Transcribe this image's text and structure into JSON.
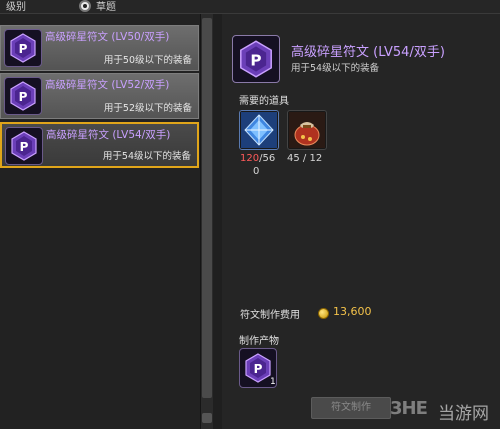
{
  "topbar": {
    "level_label": "级别",
    "radio_label": "草题"
  },
  "recipes": [
    {
      "title": "高级碎星符文 (LV50/双手)",
      "subtitle": "用于50级以下的装备",
      "selected": false
    },
    {
      "title": "高级碎星符文 (LV52/双手)",
      "subtitle": "用于52级以下的装备",
      "selected": false
    },
    {
      "title": "高级碎星符文 (LV54/双手)",
      "subtitle": "用于54级以下的装备",
      "selected": true
    }
  ],
  "detail": {
    "title": "高级碎星符文 (LV54/双手)",
    "subtitle": "用于54级以下的装备",
    "materials_label": "需要的道具",
    "materials": [
      {
        "icon": "blue-crystal-icon",
        "have": "120",
        "need_line1": "/56",
        "need_line2": "0"
      },
      {
        "icon": "red-pouch-icon",
        "have": "45",
        "need_line1": " / 12",
        "need_line2": ""
      }
    ],
    "cost_label": "符文制作费用",
    "cost_value": "13,600",
    "product_label": "制作产物",
    "product_qty": "1",
    "craft_button": "符文制作"
  },
  "watermark": {
    "logo": "3HE",
    "text": "当游网"
  },
  "colors": {
    "accent_selected": "#e0a51a",
    "rune_name": "#c9a0ff",
    "insufficient": "#ff5a5a",
    "gold": "#f3c24a"
  }
}
